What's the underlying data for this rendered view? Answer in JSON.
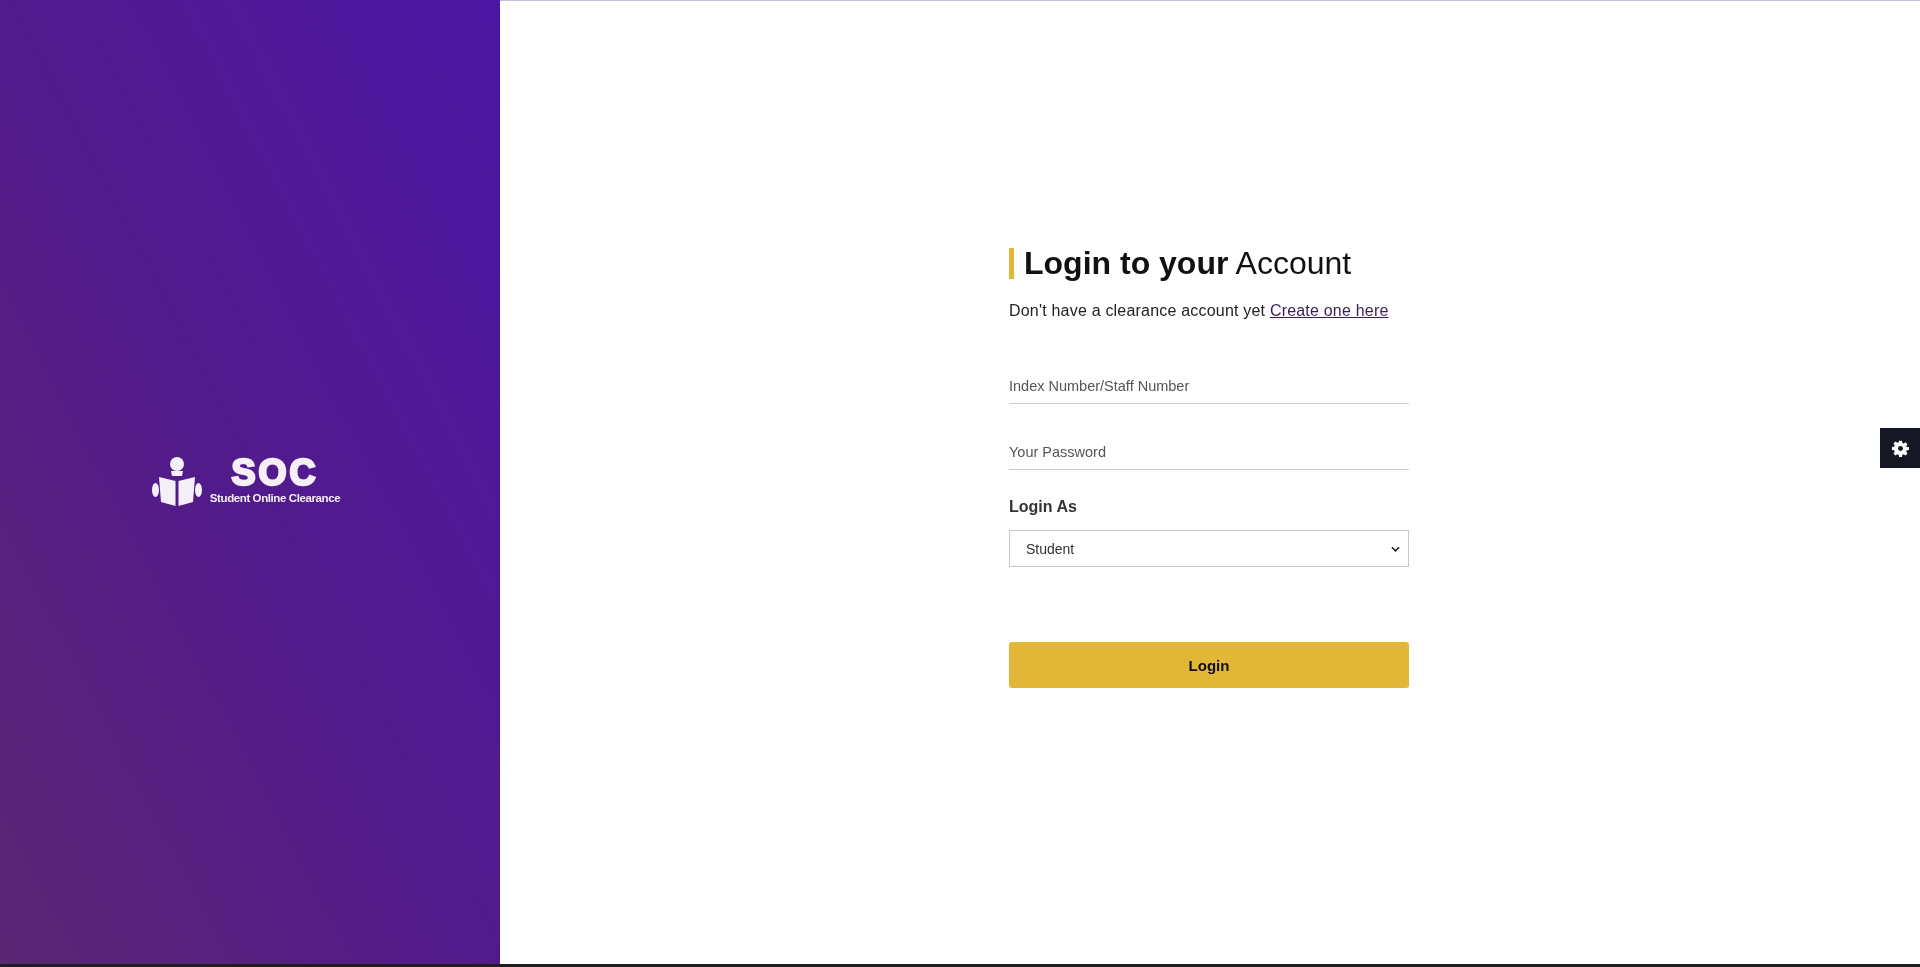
{
  "brand": {
    "logo_title": "SOC",
    "logo_subtitle": "Student Online Clearance"
  },
  "heading": "**Login to your** Account",
  "prompt": {
    "text": "Don't have a clearance account yet",
    "link": "Create one here"
  },
  "fields": [
    {
      "placeholder": "Index Number/Staff Number"
    },
    {
      "placeholder": "Your Password"
    }
  ],
  "login_as": {
    "label": "Login As",
    "value": "Student"
  },
  "login_button": {
    "label": "Login"
  }
}
